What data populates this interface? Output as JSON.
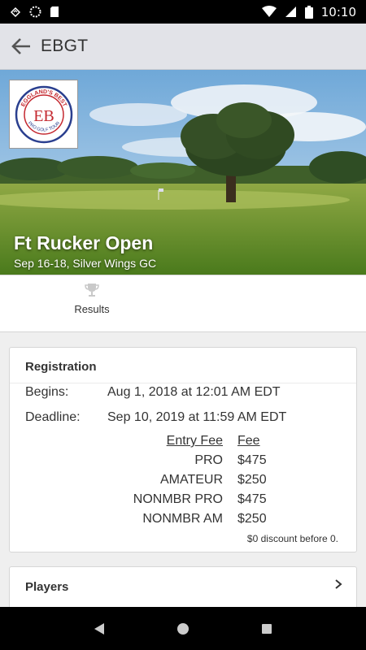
{
  "status_bar": {
    "time": "10:10",
    "icons": [
      "notification-icon",
      "sync-icon",
      "sd-card-icon",
      "wifi-icon",
      "signal-icon",
      "battery-icon"
    ]
  },
  "app_bar": {
    "title": "EBGT",
    "back_icon": "arrow-left-icon"
  },
  "event": {
    "logo_top_text": "EGGLAND'S BEST",
    "logo_initials": "EB",
    "logo_bottom_text": "PRO GOLF TOUR",
    "name": "Ft Rucker Open",
    "subtitle": "Sep 16-18, Silver Wings GC"
  },
  "actions": {
    "results_label": "Results",
    "results_icon": "trophy-icon"
  },
  "registration": {
    "title": "Registration",
    "begins_label": "Begins:",
    "begins_value": "Aug 1, 2018 at 12:01 AM EDT",
    "deadline_label": "Deadline:",
    "deadline_value": "Sep 10, 2019 at 11:59 AM EDT",
    "fee_header_name": "Entry Fee",
    "fee_header_value": "Fee",
    "fees": [
      {
        "name": "PRO",
        "fee": "$475"
      },
      {
        "name": "AMATEUR",
        "fee": "$250"
      },
      {
        "name": "NONMBR PRO",
        "fee": "$475"
      },
      {
        "name": "NONMBR AM",
        "fee": "$250"
      }
    ],
    "discount_note": "$0 discount before 0."
  },
  "players": {
    "title": "Players",
    "chevron_icon": "chevron-right-icon"
  },
  "nav_bar": {
    "icons": [
      "back-triangle-icon",
      "home-circle-icon",
      "recents-square-icon"
    ]
  },
  "colors": {
    "app_bar_bg": "#e2e3e8",
    "logo_red": "#c4282f",
    "logo_blue": "#2a3f8f"
  }
}
